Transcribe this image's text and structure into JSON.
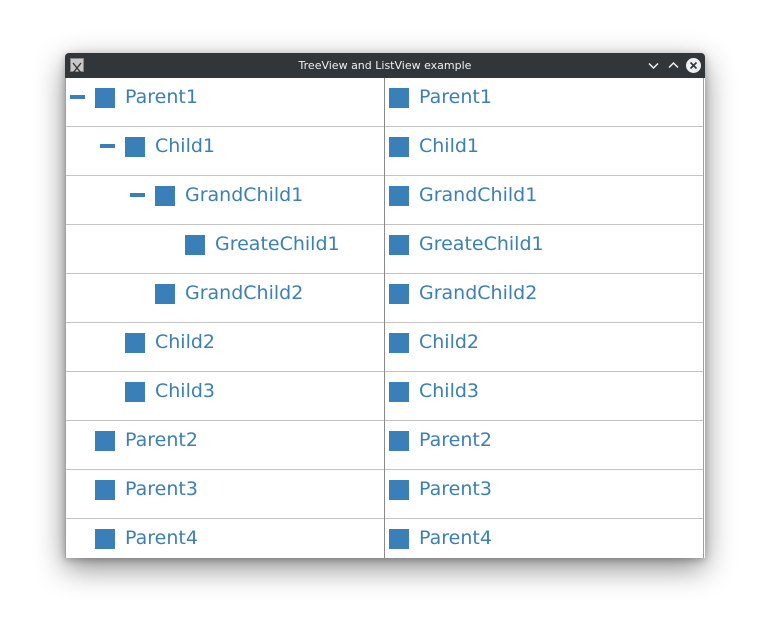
{
  "window": {
    "title": "TreeView and ListView example"
  },
  "colors": {
    "titlebar": "#31363b",
    "accent": "#3a7fb8",
    "row_separator": "#c4c4c4",
    "title_text": "#eff0f1"
  },
  "icons": {
    "app": "x11-app-icon",
    "minimize": "chevron-down-icon",
    "maximize": "chevron-up-icon",
    "close": "close-circle-icon",
    "item": "square-icon",
    "toggle": "collapse-minus-icon"
  },
  "tree": {
    "items": [
      {
        "label": "Parent1",
        "level": 0,
        "expanded": true
      },
      {
        "label": "Child1",
        "level": 1,
        "expanded": true
      },
      {
        "label": "GrandChild1",
        "level": 2,
        "expanded": true
      },
      {
        "label": "GreateChild1",
        "level": 3,
        "expanded": null
      },
      {
        "label": "GrandChild2",
        "level": 2,
        "expanded": null
      },
      {
        "label": "Child2",
        "level": 1,
        "expanded": null
      },
      {
        "label": "Child3",
        "level": 1,
        "expanded": null
      },
      {
        "label": "Parent2",
        "level": 0,
        "expanded": null
      },
      {
        "label": "Parent3",
        "level": 0,
        "expanded": null
      },
      {
        "label": "Parent4",
        "level": 0,
        "expanded": null
      }
    ]
  },
  "list": {
    "items": [
      {
        "label": "Parent1"
      },
      {
        "label": "Child1"
      },
      {
        "label": "GrandChild1"
      },
      {
        "label": "GreateChild1"
      },
      {
        "label": "GrandChild2"
      },
      {
        "label": "Child2"
      },
      {
        "label": "Child3"
      },
      {
        "label": "Parent2"
      },
      {
        "label": "Parent3"
      },
      {
        "label": "Parent4"
      }
    ]
  }
}
